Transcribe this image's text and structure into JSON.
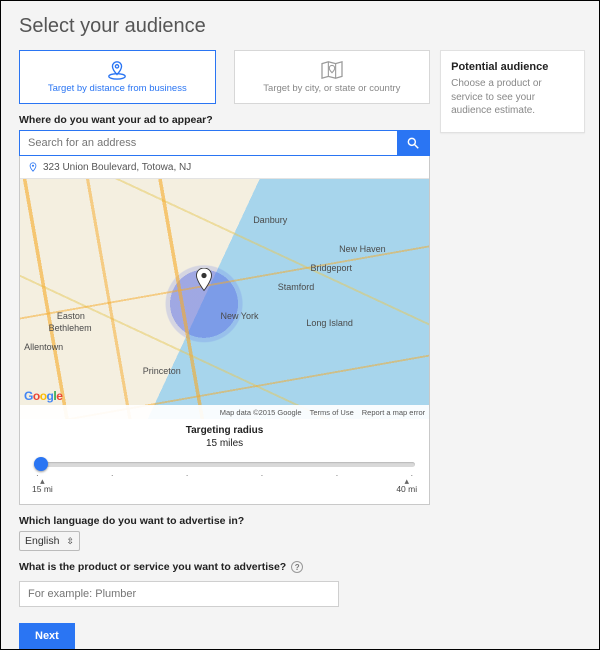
{
  "title": "Select your audience",
  "tabs": {
    "distance": "Target by distance from business",
    "location": "Target by city, or state or country"
  },
  "question_where": "Where do you want your ad to appear?",
  "search": {
    "placeholder": "Search for an address"
  },
  "pinned_address": "323 Union Boulevard, Totowa, NJ",
  "map": {
    "logo": "Google",
    "attribution": "Map data ©2015 Google",
    "terms": "Terms of Use",
    "report": "Report a map error",
    "labels": {
      "ny": "New York",
      "stamford": "Stamford",
      "newhaven": "New Haven",
      "danbury": "Danbury",
      "bridgeport": "Bridgeport",
      "longisland": "Long Island",
      "princeton": "Princeton",
      "allentown": "Allentown",
      "easton": "Easton",
      "bethlehem": "Bethlehem"
    }
  },
  "radius": {
    "title": "Targeting radius",
    "value": "15 miles",
    "min_label": "15 mi",
    "max_label": "40 mi"
  },
  "question_lang": "Which language do you want to advertise in?",
  "language_selected": "English",
  "question_product": "What is the product or service you want to advertise?",
  "product_placeholder": "For example: Plumber",
  "next": "Next",
  "sidebar": {
    "title": "Potential audience",
    "body": "Choose a product or service to see your audience estimate."
  }
}
